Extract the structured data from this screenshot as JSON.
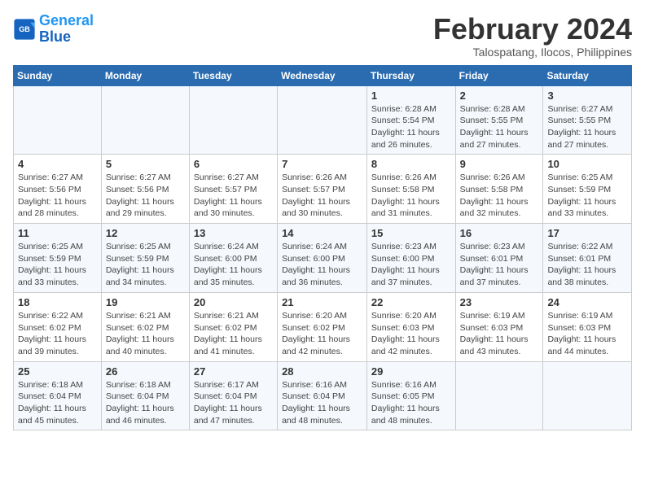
{
  "logo": {
    "line1": "General",
    "line2": "Blue"
  },
  "title": "February 2024",
  "subtitle": "Talospatang, Ilocos, Philippines",
  "days_header": [
    "Sunday",
    "Monday",
    "Tuesday",
    "Wednesday",
    "Thursday",
    "Friday",
    "Saturday"
  ],
  "weeks": [
    [
      {
        "num": "",
        "info": ""
      },
      {
        "num": "",
        "info": ""
      },
      {
        "num": "",
        "info": ""
      },
      {
        "num": "",
        "info": ""
      },
      {
        "num": "1",
        "info": "Sunrise: 6:28 AM\nSunset: 5:54 PM\nDaylight: 11 hours and 26 minutes."
      },
      {
        "num": "2",
        "info": "Sunrise: 6:28 AM\nSunset: 5:55 PM\nDaylight: 11 hours and 27 minutes."
      },
      {
        "num": "3",
        "info": "Sunrise: 6:27 AM\nSunset: 5:55 PM\nDaylight: 11 hours and 27 minutes."
      }
    ],
    [
      {
        "num": "4",
        "info": "Sunrise: 6:27 AM\nSunset: 5:56 PM\nDaylight: 11 hours and 28 minutes."
      },
      {
        "num": "5",
        "info": "Sunrise: 6:27 AM\nSunset: 5:56 PM\nDaylight: 11 hours and 29 minutes."
      },
      {
        "num": "6",
        "info": "Sunrise: 6:27 AM\nSunset: 5:57 PM\nDaylight: 11 hours and 30 minutes."
      },
      {
        "num": "7",
        "info": "Sunrise: 6:26 AM\nSunset: 5:57 PM\nDaylight: 11 hours and 30 minutes."
      },
      {
        "num": "8",
        "info": "Sunrise: 6:26 AM\nSunset: 5:58 PM\nDaylight: 11 hours and 31 minutes."
      },
      {
        "num": "9",
        "info": "Sunrise: 6:26 AM\nSunset: 5:58 PM\nDaylight: 11 hours and 32 minutes."
      },
      {
        "num": "10",
        "info": "Sunrise: 6:25 AM\nSunset: 5:59 PM\nDaylight: 11 hours and 33 minutes."
      }
    ],
    [
      {
        "num": "11",
        "info": "Sunrise: 6:25 AM\nSunset: 5:59 PM\nDaylight: 11 hours and 33 minutes."
      },
      {
        "num": "12",
        "info": "Sunrise: 6:25 AM\nSunset: 5:59 PM\nDaylight: 11 hours and 34 minutes."
      },
      {
        "num": "13",
        "info": "Sunrise: 6:24 AM\nSunset: 6:00 PM\nDaylight: 11 hours and 35 minutes."
      },
      {
        "num": "14",
        "info": "Sunrise: 6:24 AM\nSunset: 6:00 PM\nDaylight: 11 hours and 36 minutes."
      },
      {
        "num": "15",
        "info": "Sunrise: 6:23 AM\nSunset: 6:00 PM\nDaylight: 11 hours and 37 minutes."
      },
      {
        "num": "16",
        "info": "Sunrise: 6:23 AM\nSunset: 6:01 PM\nDaylight: 11 hours and 37 minutes."
      },
      {
        "num": "17",
        "info": "Sunrise: 6:22 AM\nSunset: 6:01 PM\nDaylight: 11 hours and 38 minutes."
      }
    ],
    [
      {
        "num": "18",
        "info": "Sunrise: 6:22 AM\nSunset: 6:02 PM\nDaylight: 11 hours and 39 minutes."
      },
      {
        "num": "19",
        "info": "Sunrise: 6:21 AM\nSunset: 6:02 PM\nDaylight: 11 hours and 40 minutes."
      },
      {
        "num": "20",
        "info": "Sunrise: 6:21 AM\nSunset: 6:02 PM\nDaylight: 11 hours and 41 minutes."
      },
      {
        "num": "21",
        "info": "Sunrise: 6:20 AM\nSunset: 6:02 PM\nDaylight: 11 hours and 42 minutes."
      },
      {
        "num": "22",
        "info": "Sunrise: 6:20 AM\nSunset: 6:03 PM\nDaylight: 11 hours and 42 minutes."
      },
      {
        "num": "23",
        "info": "Sunrise: 6:19 AM\nSunset: 6:03 PM\nDaylight: 11 hours and 43 minutes."
      },
      {
        "num": "24",
        "info": "Sunrise: 6:19 AM\nSunset: 6:03 PM\nDaylight: 11 hours and 44 minutes."
      }
    ],
    [
      {
        "num": "25",
        "info": "Sunrise: 6:18 AM\nSunset: 6:04 PM\nDaylight: 11 hours and 45 minutes."
      },
      {
        "num": "26",
        "info": "Sunrise: 6:18 AM\nSunset: 6:04 PM\nDaylight: 11 hours and 46 minutes."
      },
      {
        "num": "27",
        "info": "Sunrise: 6:17 AM\nSunset: 6:04 PM\nDaylight: 11 hours and 47 minutes."
      },
      {
        "num": "28",
        "info": "Sunrise: 6:16 AM\nSunset: 6:04 PM\nDaylight: 11 hours and 48 minutes."
      },
      {
        "num": "29",
        "info": "Sunrise: 6:16 AM\nSunset: 6:05 PM\nDaylight: 11 hours and 48 minutes."
      },
      {
        "num": "",
        "info": ""
      },
      {
        "num": "",
        "info": ""
      }
    ]
  ]
}
